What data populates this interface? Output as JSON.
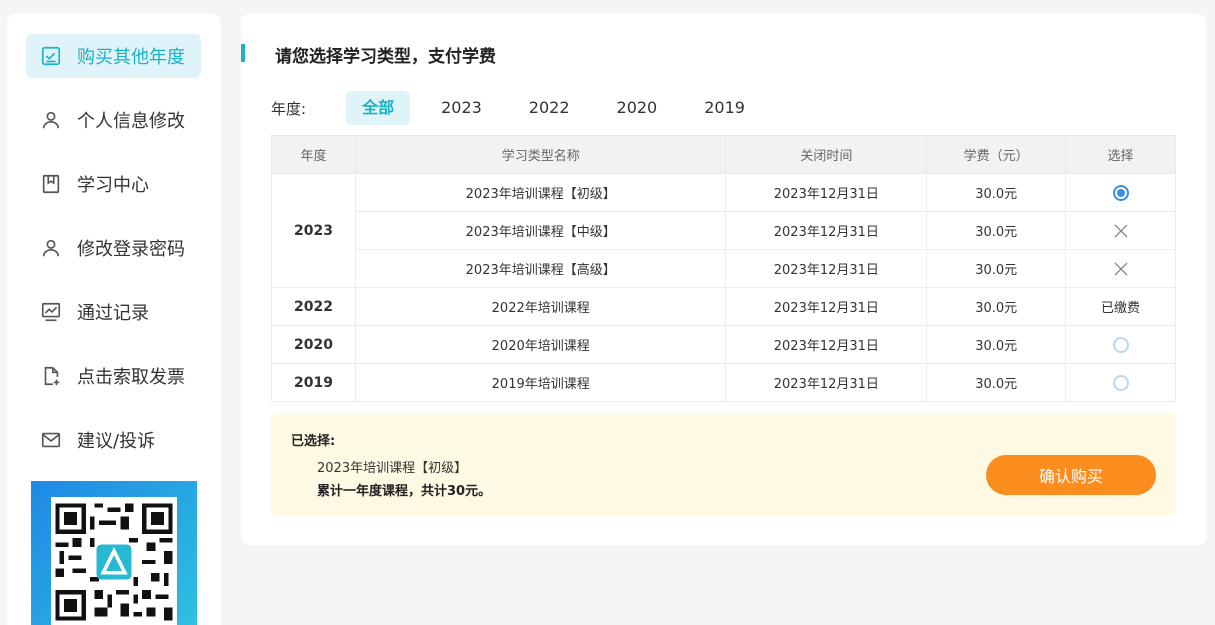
{
  "sidebar": {
    "items": [
      {
        "label": "购买其他年度",
        "icon": "check-square-icon",
        "active": true
      },
      {
        "label": "个人信息修改",
        "icon": "user-icon"
      },
      {
        "label": "学习中心",
        "icon": "bookmark-icon"
      },
      {
        "label": "修改登录密码",
        "icon": "user-icon"
      },
      {
        "label": "通过记录",
        "icon": "chart-icon"
      },
      {
        "label": "点击索取发票",
        "icon": "file-add-icon"
      },
      {
        "label": "建议/投诉",
        "icon": "mail-icon"
      }
    ],
    "qr_icon": "qr-code-icon"
  },
  "main": {
    "title": "请您选择学习类型，支付学费",
    "year_label": "年度:",
    "year_tabs": [
      "全部",
      "2023",
      "2022",
      "2020",
      "2019"
    ],
    "active_year_tab": "全部",
    "table": {
      "headers": [
        "年度",
        "学习类型名称",
        "关闭时间",
        "学费（元）",
        "选择"
      ],
      "rows": [
        {
          "year": "2023",
          "name": "2023年培训课程【初级】",
          "close": "2023年12月31日",
          "fee": "30.0元",
          "select": "radio-checked"
        },
        {
          "year": "",
          "name": "2023年培训课程【中级】",
          "close": "2023年12月31日",
          "fee": "30.0元",
          "select": "x-icon"
        },
        {
          "year": "",
          "name": "2023年培训课程【高级】",
          "close": "2023年12月31日",
          "fee": "30.0元",
          "select": "x-icon"
        },
        {
          "year": "2022",
          "name": "2022年培训课程",
          "close": "2023年12月31日",
          "fee": "30.0元",
          "select": "已缴费"
        },
        {
          "year": "2020",
          "name": "2020年培训课程",
          "close": "2023年12月31日",
          "fee": "30.0元",
          "select": "radio"
        },
        {
          "year": "2019",
          "name": "2019年培训课程",
          "close": "2023年12月31日",
          "fee": "30.0元",
          "select": "radio"
        }
      ]
    },
    "summary": {
      "label": "已选择:",
      "item": "2023年培训课程【初级】",
      "total": "累计一年度课程，共计30元。",
      "confirm_label": "确认购买"
    }
  },
  "colors": {
    "accent": "#1bb2c3",
    "accent_bg": "#dff3f8",
    "confirm": "#fb8c1e",
    "summary_bg": "#fef9e3",
    "radio_checked": "#3a8ee6"
  }
}
